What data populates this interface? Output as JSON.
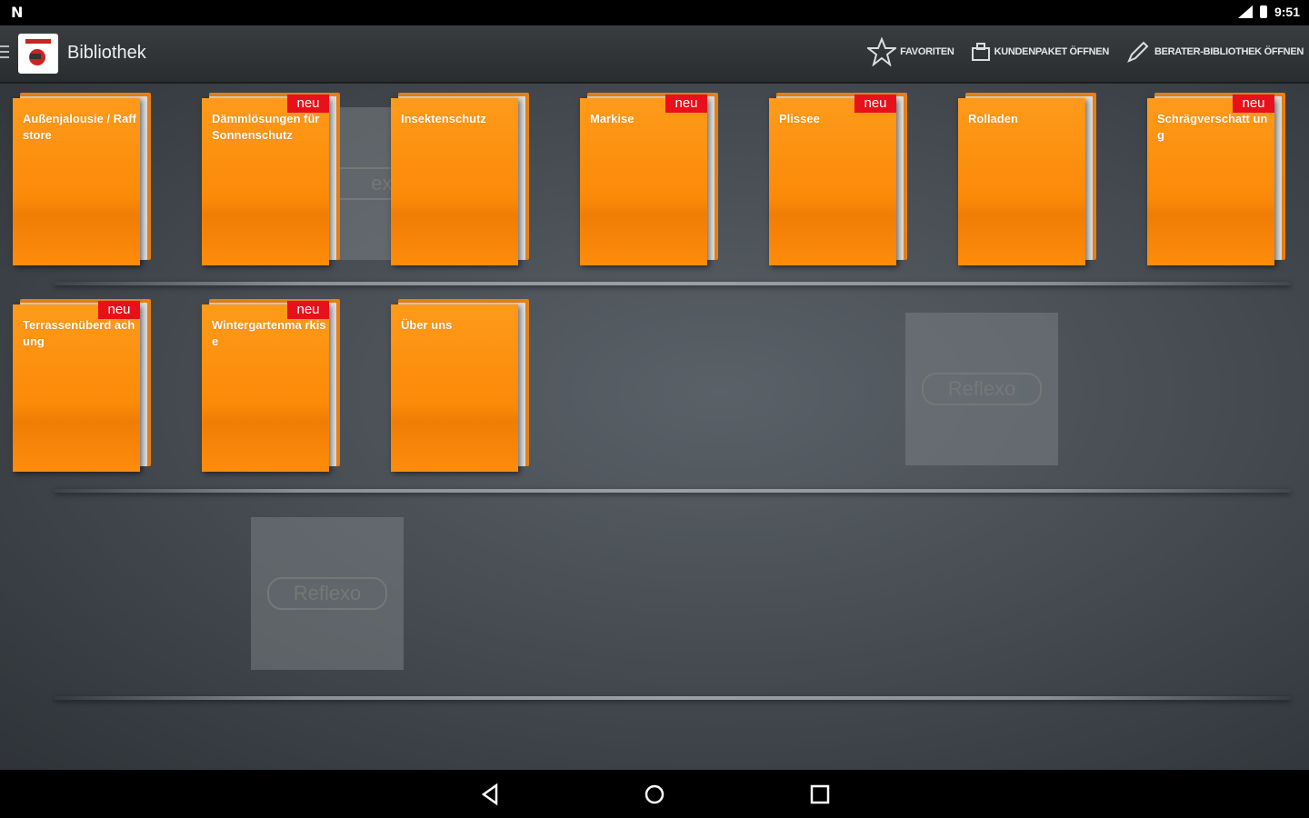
{
  "status_bar": {
    "left_icon": "N",
    "time": "9:51"
  },
  "action_bar": {
    "title": "Bibliothek",
    "actions": [
      {
        "label": "FAVORITEN",
        "icon": "star-icon"
      },
      {
        "label": "KUNDENPAKET ÖFFNEN",
        "icon": "package-icon"
      },
      {
        "label": "BERATER-BIBLIOTHEK ÖFFNEN",
        "icon": "pencil-icon"
      }
    ]
  },
  "folders": [
    {
      "label": "Außenjalousie / Raffstore",
      "badge": ""
    },
    {
      "label": "Dämmlösungen für Sonnenschutz",
      "badge": "neu"
    },
    {
      "label": "Insektenschutz",
      "badge": ""
    },
    {
      "label": "Markise",
      "badge": "neu"
    },
    {
      "label": "Plissee",
      "badge": "neu"
    },
    {
      "label": "Rolladen",
      "badge": ""
    },
    {
      "label": "Schrägverschatt ung",
      "badge": "neu"
    },
    {
      "label": "Terrassenüberd achung",
      "badge": "neu"
    },
    {
      "label": "Wintergartenma rkise",
      "badge": "neu"
    },
    {
      "label": "Über uns",
      "badge": ""
    }
  ],
  "placeholders": [
    {
      "logo": "Reflexo"
    },
    {
      "logo": "Reflexo"
    },
    {
      "logo": "exo"
    }
  ],
  "colors": {
    "folder": "#ff8c0a",
    "badge": "#e8101a",
    "background": "#4a5056"
  }
}
